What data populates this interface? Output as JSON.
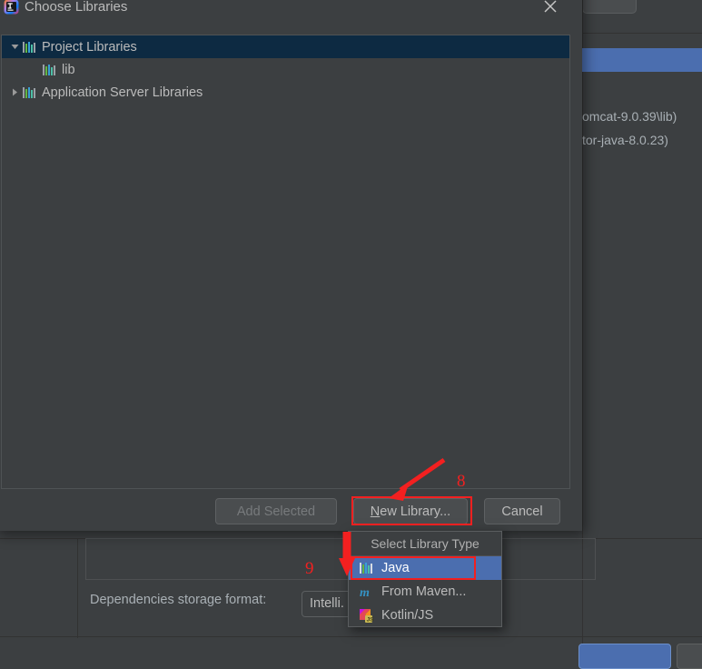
{
  "dialog": {
    "title": "Choose Libraries",
    "window_icon": "intellij-idea-logo-icon",
    "close_icon": "close-icon",
    "tree": {
      "nodes": [
        {
          "label": "Project Libraries",
          "icon": "library-icon",
          "expanded": true,
          "selected": true,
          "arrow": "chevron-down-icon",
          "indent": 0
        },
        {
          "label": "lib",
          "icon": "library-icon",
          "expanded": false,
          "selected": false,
          "arrow": "none",
          "indent": 1
        },
        {
          "label": "Application Server Libraries",
          "icon": "library-icon",
          "expanded": false,
          "selected": false,
          "arrow": "chevron-right-icon",
          "indent": 0
        }
      ]
    },
    "buttons": {
      "add_selected": "Add Selected",
      "new_library_mnemonic": "N",
      "new_library_rest": "ew Library...",
      "cancel": "Cancel"
    }
  },
  "popup": {
    "header": "Select Library Type",
    "items": [
      {
        "label": "Java",
        "icon": "library-icon",
        "selected": true
      },
      {
        "label": "From Maven...",
        "icon": "maven-icon",
        "selected": false
      },
      {
        "label": "Kotlin/JS",
        "icon": "kotlin-js-icon",
        "selected": false
      }
    ]
  },
  "background": {
    "path_fragment_1": "omcat-9.0.39\\lib)",
    "path_fragment_2": "tor-java-8.0.23)",
    "dependencies_storage_label": "Dependencies storage format:",
    "dependencies_storage_value": "Intelli."
  },
  "annotations": {
    "step_8": "8",
    "step_9": "9",
    "color": "#f32020"
  }
}
